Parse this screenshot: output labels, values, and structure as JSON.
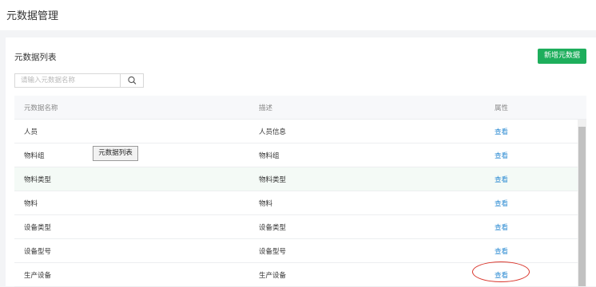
{
  "page": {
    "title": "元数据管理"
  },
  "panel": {
    "title": "元数据列表",
    "add_button": "新增元数据",
    "search": {
      "placeholder": "请输入元数据名称",
      "value": ""
    }
  },
  "table": {
    "headers": {
      "name": "元数据名称",
      "desc": "描述",
      "attr": "属性"
    },
    "rows": [
      {
        "name": "人员",
        "desc": "人员信息",
        "attr": "查看"
      },
      {
        "name": "物料组",
        "desc": "物料组",
        "attr": "查看"
      },
      {
        "name": "物料类型",
        "desc": "物料类型",
        "attr": "查看"
      },
      {
        "name": "物料",
        "desc": "物料",
        "attr": "查看"
      },
      {
        "name": "设备类型",
        "desc": "设备类型",
        "attr": "查看"
      },
      {
        "name": "设备型号",
        "desc": "设备型号",
        "attr": "查看"
      },
      {
        "name": "生产设备",
        "desc": "生产设备",
        "attr": "查看"
      }
    ]
  },
  "tooltip": {
    "text": "元数据列表"
  },
  "icons": {
    "search": "search-icon",
    "scroll_up": "chevron-up-icon"
  },
  "colors": {
    "accent": "#1eae5c",
    "link": "#2a8ad2",
    "annotation": "#d9352b"
  }
}
